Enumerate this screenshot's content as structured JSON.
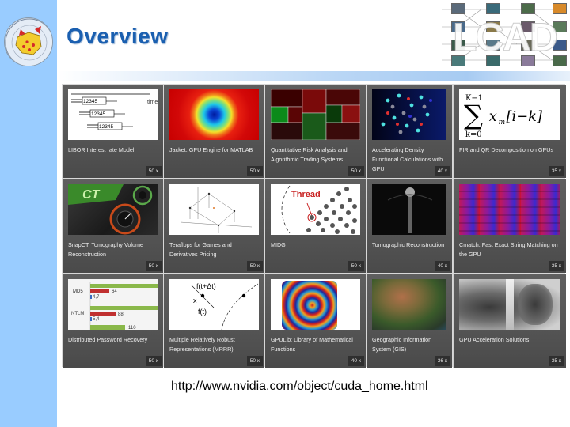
{
  "slide": {
    "title": "Overview",
    "logo": "university-crest",
    "corner_logo_text": "LCAD",
    "footer_url": "http://www.nvidia.com/object/cuda_home.html"
  },
  "grid": {
    "tiles": [
      {
        "label": "LIBOR Interest rate Model",
        "speedup": "50 x",
        "image": "libor-timeline-diagram"
      },
      {
        "label": "Jacket: GPU Engine for MATLAB",
        "speedup": "50 x",
        "image": "heatmap-radial"
      },
      {
        "label": "Quantitative Risk Analysis and Algorithmic Trading Systems",
        "speedup": "50 x",
        "image": "treemap-market"
      },
      {
        "label": "Accelerating Density Functional Calculations with GPU",
        "speedup": "40 x",
        "image": "molecule-particles"
      },
      {
        "label": "FIR and QR Decomposition on GPUs",
        "speedup": "35 x",
        "image": "summation-formula"
      },
      {
        "label": "SnapCT: Tomography Volume Reconstruction",
        "speedup": "50 x",
        "image": "snapct-gauges"
      },
      {
        "label": "Teraflops for Games and Derivatives Pricing",
        "speedup": "50 x",
        "image": "3d-lattice-plot"
      },
      {
        "label": "MIDG",
        "speedup": "50 x",
        "image": "thread-spheres"
      },
      {
        "label": "Tomographic Reconstruction",
        "speedup": "40 x",
        "image": "xray-spine"
      },
      {
        "label": "Cmatch: Fast Exact String Matching on the GPU",
        "speedup": "35 x",
        "image": "red-blue-mosaic"
      },
      {
        "label": "Distributed Password Recovery",
        "speedup": "50 x",
        "image": "bar-chart-md5-ntlm"
      },
      {
        "label": "Multiple Relatively Robust Representations (MRRR)",
        "speedup": "50 x",
        "image": "curve-diagram"
      },
      {
        "label": "GPULib: Library of Mathematical Functions",
        "speedup": "40 x",
        "image": "color-spiral"
      },
      {
        "label": "Geographic Information System (GIS)",
        "speedup": "36 x",
        "image": "satellite-terrain"
      },
      {
        "label": "GPU Acceleration Solutions",
        "speedup": "35 x",
        "image": "chest-xray"
      }
    ],
    "image_text": {
      "libor_time": "time",
      "libor_digits": "12345",
      "formula_upper": "K−1",
      "formula_lower": "k=0",
      "formula_body": "x",
      "formula_sub": "m",
      "formula_tail": "[i−k]",
      "midg_thread": "Thread",
      "mrrr_top": "f(t+Δt)",
      "mrrr_x": "x",
      "mrrr_bottom": "f(t)",
      "pw_md5": "MD5",
      "pw_ntlm": "NTLM",
      "pw_v1": "64",
      "pw_v2": "4,7",
      "pw_v3": "88",
      "pw_v4": "5,4",
      "pw_v5": "110"
    }
  }
}
